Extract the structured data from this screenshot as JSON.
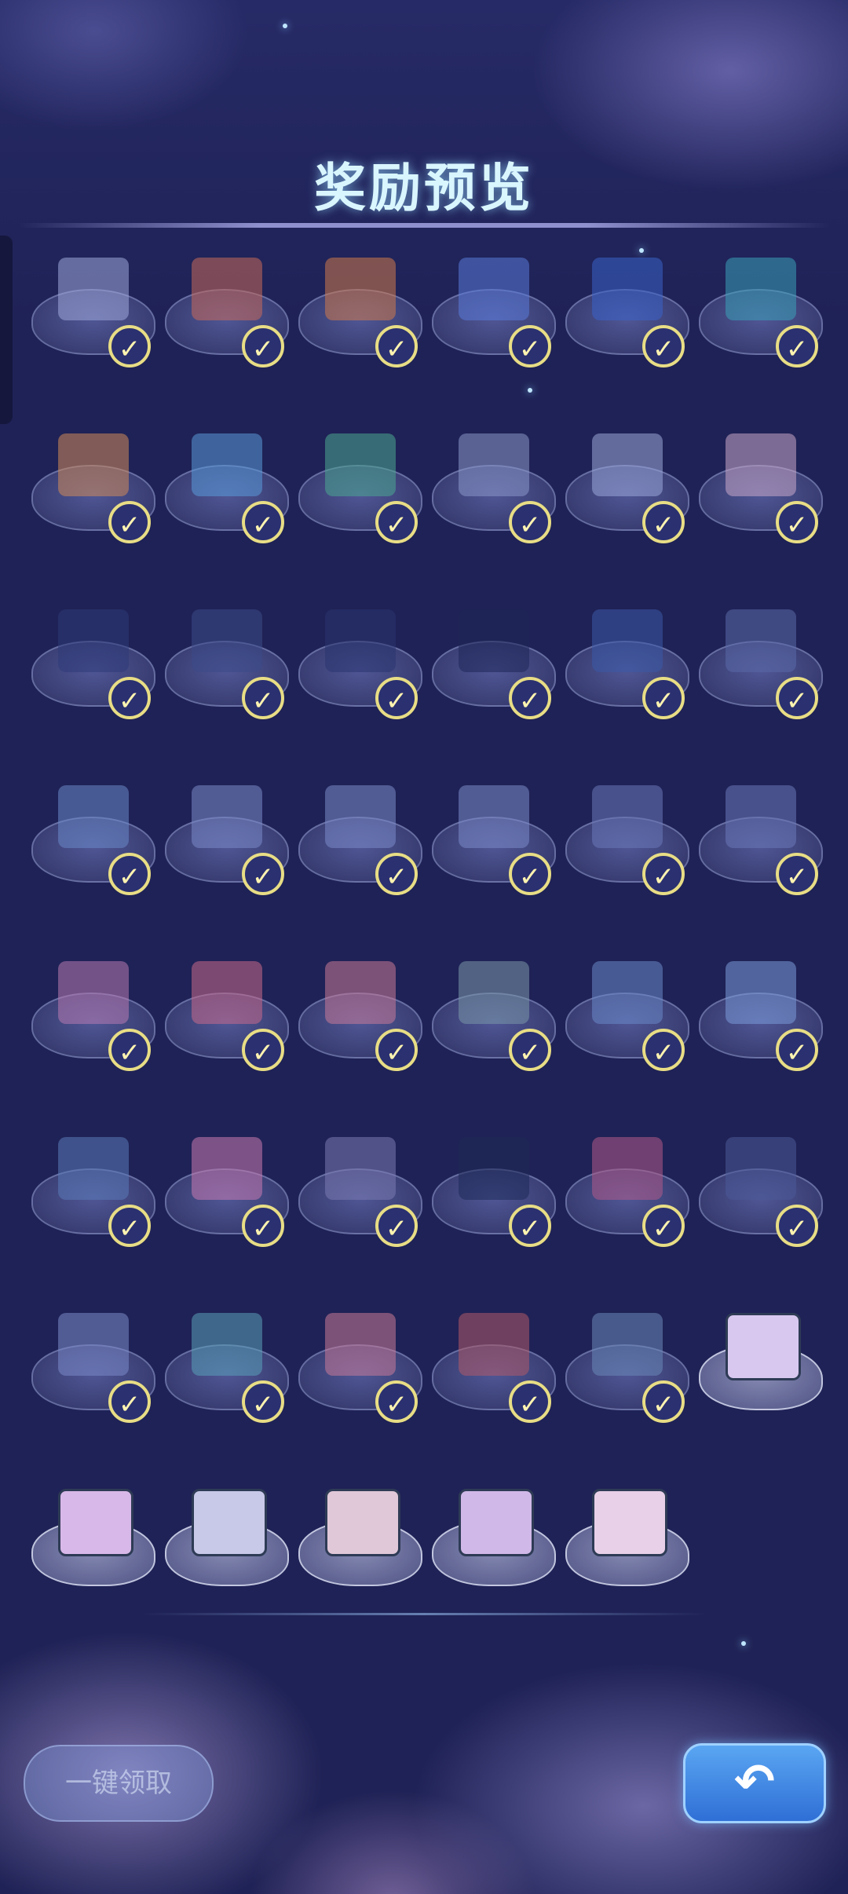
{
  "header": {
    "title": "奖励预览"
  },
  "rewards": [
    [
      {
        "icon": "cat-robot-icon",
        "claimed": true,
        "color": "#9fa7d8"
      },
      {
        "icon": "red-box-icon",
        "claimed": true,
        "color": "#c86a5a"
      },
      {
        "icon": "blue-orange-sofa-icon",
        "claimed": true,
        "color": "#d07a4a"
      },
      {
        "icon": "blue-chair-icon",
        "claimed": true,
        "color": "#5a7ad8"
      },
      {
        "icon": "blue-bed-icon",
        "claimed": true,
        "color": "#3a62c8"
      },
      {
        "icon": "teal-cabinet-icon",
        "claimed": true,
        "color": "#3aa0b8"
      }
    ],
    [
      {
        "icon": "sun-lamp-icon",
        "claimed": true,
        "color": "#d08a5a"
      },
      {
        "icon": "moon-lamp-icon",
        "claimed": true,
        "color": "#5a9ad8"
      },
      {
        "icon": "green-light-beam-icon",
        "claimed": true,
        "color": "#4aa890"
      },
      {
        "icon": "white-light-beam-icon",
        "claimed": true,
        "color": "#8a98c8"
      },
      {
        "icon": "spotlight-icon",
        "claimed": true,
        "color": "#9aa8d8"
      },
      {
        "icon": "rainbow-panel-icon",
        "claimed": true,
        "color": "#c8a8c8"
      }
    ],
    [
      {
        "icon": "striped-wall-icon",
        "claimed": true,
        "color": "#2e3a78"
      },
      {
        "icon": "diagonal-wall-icon",
        "claimed": true,
        "color": "#3a4a88"
      },
      {
        "icon": "plain-wall-icon",
        "claimed": true,
        "color": "#2a3470"
      },
      {
        "icon": "dark-wall-icon",
        "claimed": true,
        "color": "#1e2658"
      },
      {
        "icon": "grid-wall-icon",
        "claimed": true,
        "color": "#3a5aa8"
      },
      {
        "icon": "stripe-panel-icon",
        "claimed": true,
        "color": "#5a6aa8"
      }
    ],
    [
      {
        "icon": "double-bar-icon",
        "claimed": true,
        "color": "#6a88c8"
      },
      {
        "icon": "chevron-up-icon",
        "claimed": true,
        "color": "#7a8ac8"
      },
      {
        "icon": "chevron-down-icon",
        "claimed": true,
        "color": "#7a8ac8"
      },
      {
        "icon": "double-left-arrow-icon",
        "claimed": true,
        "color": "#7a8ac8"
      },
      {
        "icon": "left-arrows-icon",
        "claimed": true,
        "color": "#6a78b8"
      },
      {
        "icon": "up-arrows-icon",
        "claimed": true,
        "color": "#6a78b8"
      }
    ],
    [
      {
        "icon": "donut-rug-icon",
        "claimed": true,
        "color": "#b87ab0"
      },
      {
        "icon": "cake-table-icon",
        "claimed": true,
        "color": "#c86a8a"
      },
      {
        "icon": "starfish-icon",
        "claimed": true,
        "color": "#c87a98"
      },
      {
        "icon": "food-plate-icon",
        "claimed": true,
        "color": "#7a98a8"
      },
      {
        "icon": "stone-icon",
        "claimed": true,
        "color": "#6a88c8"
      },
      {
        "icon": "moon-boat-icon",
        "claimed": true,
        "color": "#7a9ad8"
      }
    ],
    [
      {
        "icon": "ship-wheel-icon",
        "claimed": true,
        "color": "#5a7ab8"
      },
      {
        "icon": "ice-cream-icon",
        "claimed": true,
        "color": "#c87ab0"
      },
      {
        "icon": "button-board-icon",
        "claimed": true,
        "color": "#7a7ab0"
      },
      {
        "icon": "dark-pillar-icon",
        "claimed": true,
        "color": "#1e2a58"
      },
      {
        "icon": "pink-pillar-icon",
        "claimed": true,
        "color": "#b05a88"
      },
      {
        "icon": "arched-door-icon",
        "claimed": true,
        "color": "#4a5a98"
      }
    ],
    [
      {
        "icon": "astronaut-lamp-icon",
        "claimed": true,
        "color": "#7a8ac8"
      },
      {
        "icon": "lounge-chair-icon",
        "claimed": true,
        "color": "#5aa0b8"
      },
      {
        "icon": "pink-pod-icon",
        "claimed": true,
        "color": "#c87a98"
      },
      {
        "icon": "globe-tower-icon",
        "claimed": true,
        "color": "#b05a68"
      },
      {
        "icon": "digital-clock-icon",
        "claimed": true,
        "color": "#6a88b8"
      },
      {
        "icon": "pastel-tile-icon",
        "claimed": false,
        "color": "#d8c8f0"
      }
    ],
    [
      {
        "icon": "pastel-tile-icon",
        "claimed": false,
        "color": "#d8b8e8"
      },
      {
        "icon": "pastel-tile-icon",
        "claimed": false,
        "color": "#c8c8e8"
      },
      {
        "icon": "pastel-tile-icon",
        "claimed": false,
        "color": "#e0c8d8"
      },
      {
        "icon": "pastel-tile-icon",
        "claimed": false,
        "color": "#d0b8e8"
      },
      {
        "icon": "pastel-tile-icon",
        "claimed": false,
        "color": "#e8d0e8"
      }
    ]
  ],
  "footer": {
    "claim_all_label": "一键领取",
    "back_label": "↶"
  },
  "theme": {
    "background": "#1f2256",
    "accent": "#e8dd85",
    "title_color": "#d9f6ff"
  }
}
